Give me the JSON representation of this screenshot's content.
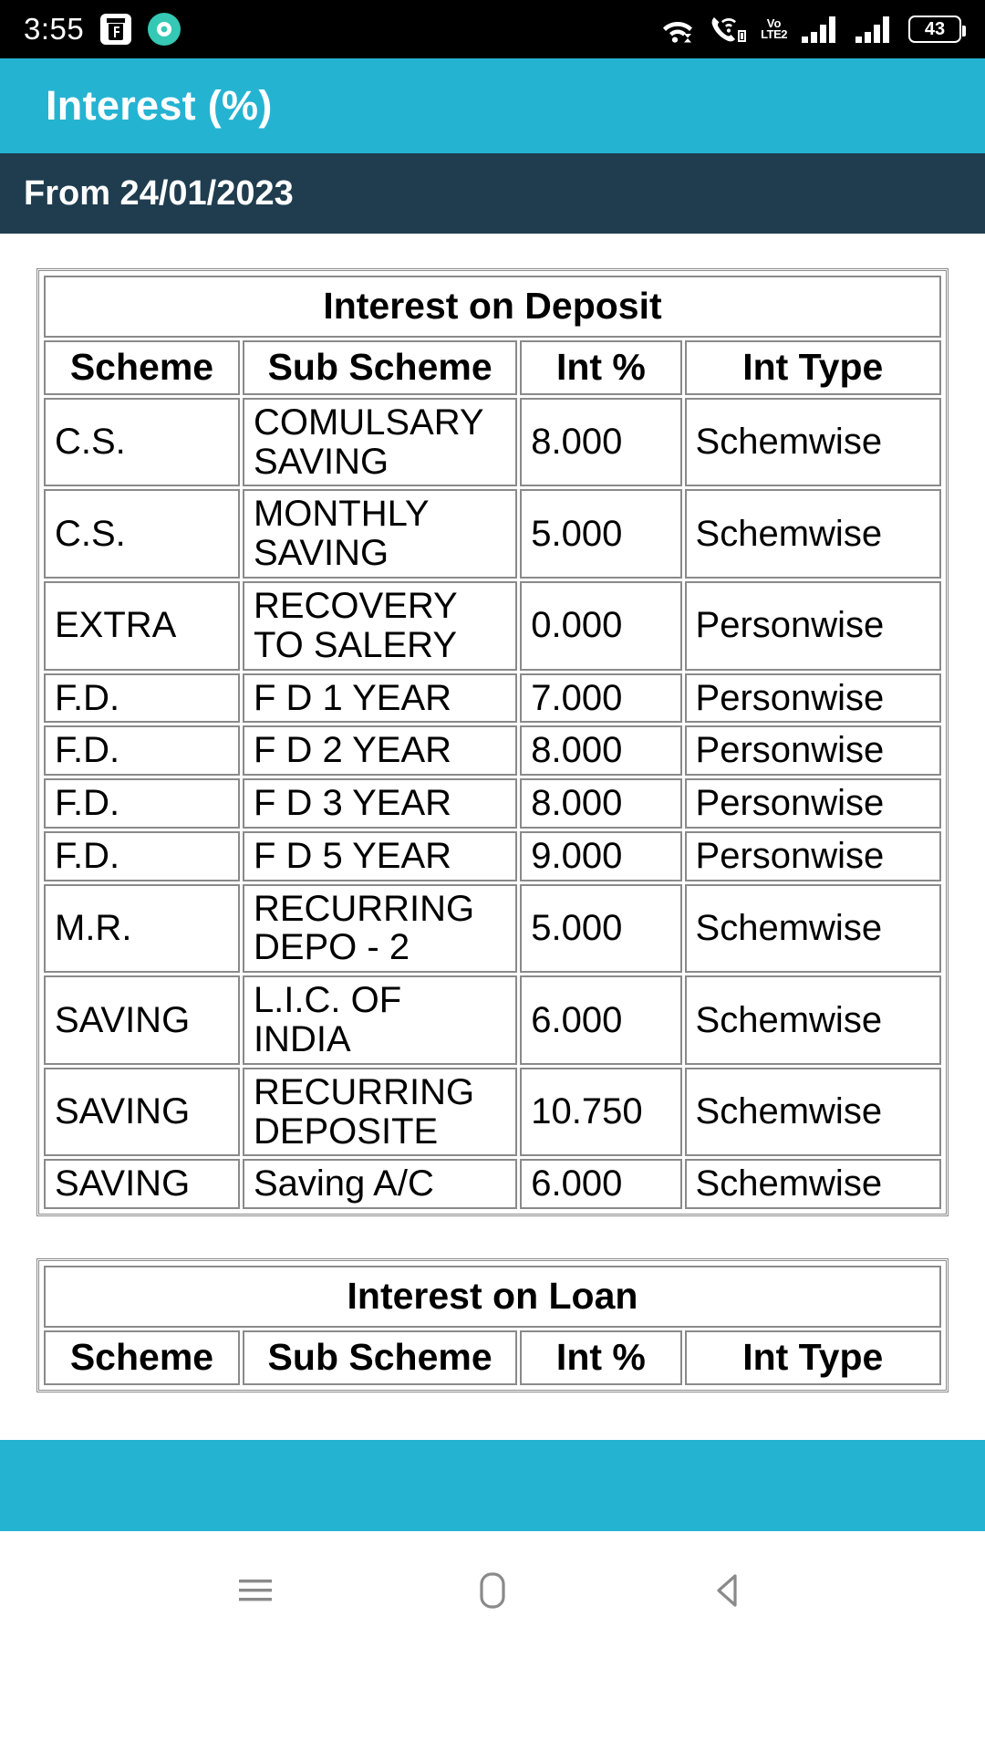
{
  "statusbar": {
    "time": "3:55",
    "icons": [
      {
        "name": "flipkart-app-icon"
      },
      {
        "name": "teal-app-icon"
      },
      {
        "name": "wifi-icon"
      },
      {
        "name": "wifi-calling-icon"
      },
      {
        "name": "volte-icon"
      },
      {
        "name": "signal-bars-sim1-icon"
      },
      {
        "name": "signal-bars-sim2-icon"
      },
      {
        "name": "battery-icon"
      }
    ],
    "volte_top": "Vo",
    "volte_bottom": "LTE2",
    "battery_percent": "43"
  },
  "appbar": {
    "title": "Interest (%)",
    "background": "#25b3d2"
  },
  "subbar": {
    "text": "From 24/01/2023",
    "background": "#1f3d4f"
  },
  "deposit_table": {
    "caption": "Interest on Deposit",
    "columns": [
      "Scheme",
      "Sub Scheme",
      "Int %",
      "Int Type"
    ],
    "rows": [
      [
        "C.S.",
        "COMULSARY SAVING",
        "8.000",
        "Schemwise"
      ],
      [
        "C.S.",
        "MONTHLY SAVING",
        "5.000",
        "Schemwise"
      ],
      [
        "EXTRA",
        "RECOVERY TO SALERY",
        "0.000",
        "Personwise"
      ],
      [
        "F.D.",
        "F D 1 YEAR",
        "7.000",
        "Personwise"
      ],
      [
        "F.D.",
        "F D 2 YEAR",
        "8.000",
        "Personwise"
      ],
      [
        "F.D.",
        "F D 3 YEAR",
        "8.000",
        "Personwise"
      ],
      [
        "F.D.",
        "F D 5 YEAR",
        "9.000",
        "Personwise"
      ],
      [
        "M.R.",
        "RECURRING DEPO - 2",
        "5.000",
        "Schemwise"
      ],
      [
        "SAVING",
        "L.I.C. OF INDIA",
        "6.000",
        "Schemwise"
      ],
      [
        "SAVING",
        "RECURRING DEPOSITE",
        "10.750",
        "Schemwise"
      ],
      [
        "SAVING",
        "Saving A/C",
        "6.000",
        "Schemwise"
      ]
    ]
  },
  "loan_table": {
    "caption": "Interest on Loan",
    "columns": [
      "Scheme",
      "Sub Scheme",
      "Int %",
      "Int Type"
    ],
    "rows": []
  },
  "bottombar": {
    "background": "#25b3d2"
  },
  "navbar": {
    "menu_label": "menu-icon",
    "home_label": "home-icon",
    "back_label": "back-icon"
  }
}
